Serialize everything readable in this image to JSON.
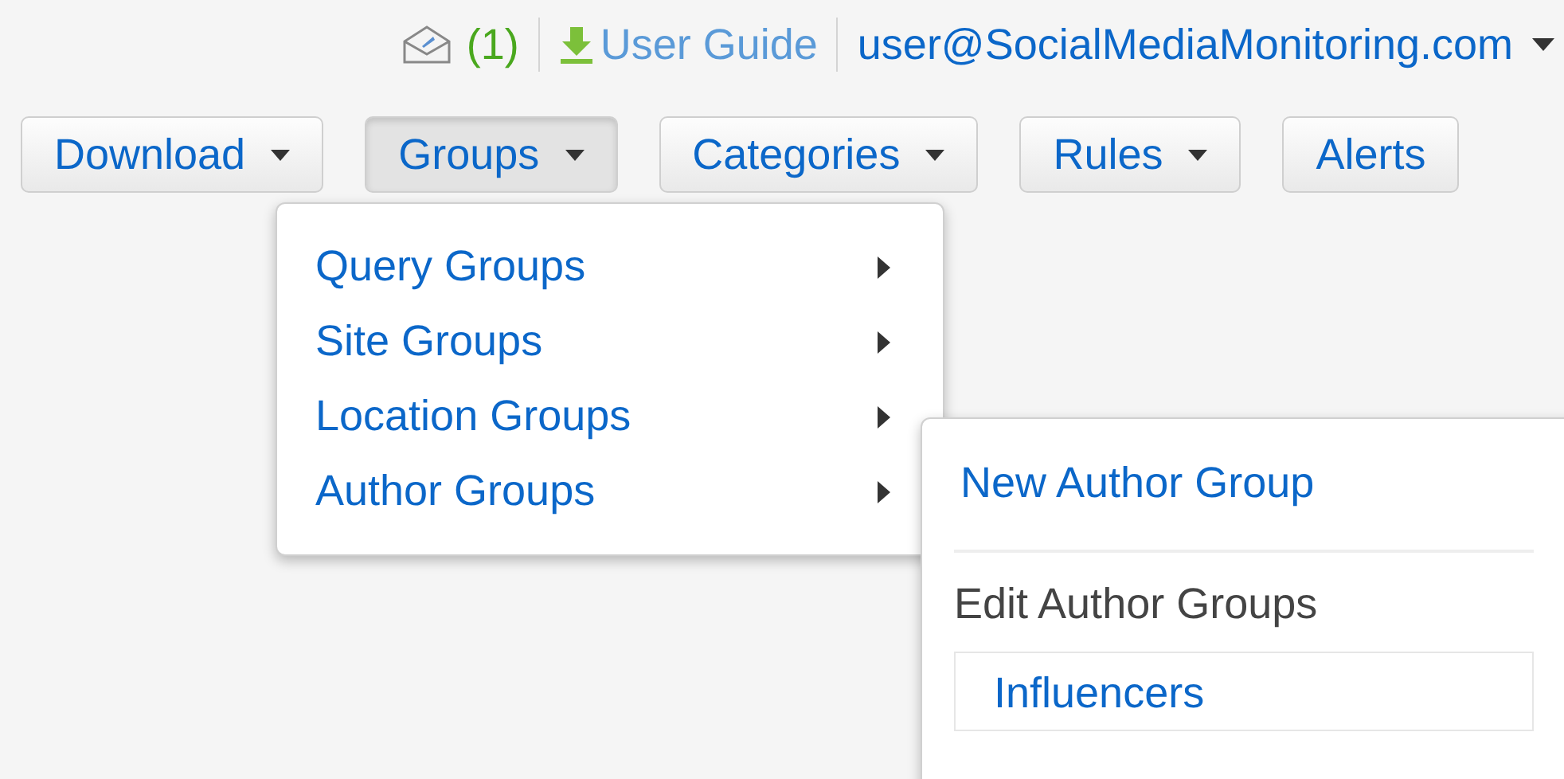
{
  "top_bar": {
    "message_count": "(1)",
    "guide_link": "User Guide",
    "account": "user@SocialMediaMonitoring.com"
  },
  "toolbar": [
    {
      "label": "Download",
      "selected": false
    },
    {
      "label": "Groups",
      "selected": true
    },
    {
      "label": "Categories",
      "selected": false
    },
    {
      "label": "Rules",
      "selected": false
    },
    {
      "label": "Alerts",
      "selected": false
    }
  ],
  "groups_menu": [
    {
      "label": "Query Groups"
    },
    {
      "label": "Site Groups"
    },
    {
      "label": "Location Groups"
    },
    {
      "label": "Author Groups"
    }
  ],
  "author_submenu": [
    {
      "kind": "link",
      "label": "New Author Group"
    },
    {
      "kind": "divider"
    },
    {
      "kind": "header",
      "label": "Edit Author Groups"
    },
    {
      "kind": "entry",
      "label": "Influencers"
    }
  ]
}
